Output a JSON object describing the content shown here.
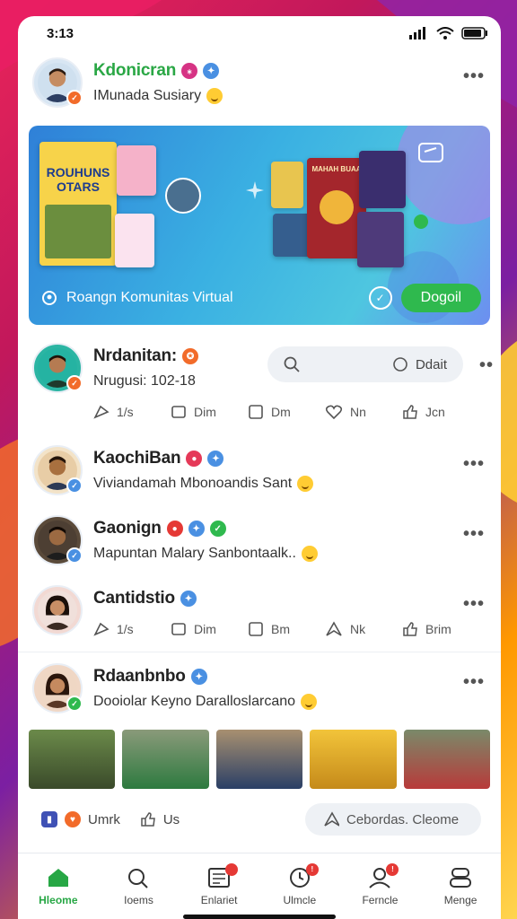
{
  "status": {
    "time": "3:13"
  },
  "feed": {
    "post1": {
      "name": "Kdonicran",
      "subtitle": "IMunada Susiary"
    },
    "banner": {
      "title": "Roangn Komunitas Virtual",
      "join_label": "Dogoil",
      "poster_title": "ROUHUNS OTARS",
      "poster_title2": "MAHAH BUAA"
    },
    "post2": {
      "name": "Nrdanitan:",
      "subtitle": "Nrugusi: 102-18",
      "search_label": "Ddait",
      "actions": [
        "1/s",
        "Dim",
        "Dm",
        "Nn",
        "Jcn"
      ]
    },
    "post3": {
      "name": "KaochiBan",
      "subtitle": "Viviandamah Mbonoandis Sant"
    },
    "post4": {
      "name": "Gaonign",
      "subtitle": "Mapuntan Malary Sanbontaalk.."
    },
    "post5": {
      "name": "Cantidstio",
      "actions": [
        "1/s",
        "Dim",
        "Bm",
        "Nk",
        "Brim"
      ]
    },
    "post6": {
      "name": "Rdaanbnbo",
      "subtitle": "Dooiolar Keyno Daralloslarcano",
      "footer_label1": "Umrk",
      "footer_label2": "Us",
      "comment_label": "Cebordas. Cleome"
    }
  },
  "tabs": [
    {
      "label": "Hleome",
      "icon": "home-icon"
    },
    {
      "label": "Ioems",
      "icon": "search-icon"
    },
    {
      "label": "Enlariet",
      "icon": "calendar-icon"
    },
    {
      "label": "Ulmcle",
      "icon": "clock-icon"
    },
    {
      "label": "Ferncle",
      "icon": "profile-icon"
    },
    {
      "label": "Menge",
      "icon": "user-menu-icon"
    }
  ],
  "colors": {
    "accent": "#27a745",
    "brand_title": "#2aa745",
    "verified": "#4a90e2",
    "alert": "#e53935"
  }
}
